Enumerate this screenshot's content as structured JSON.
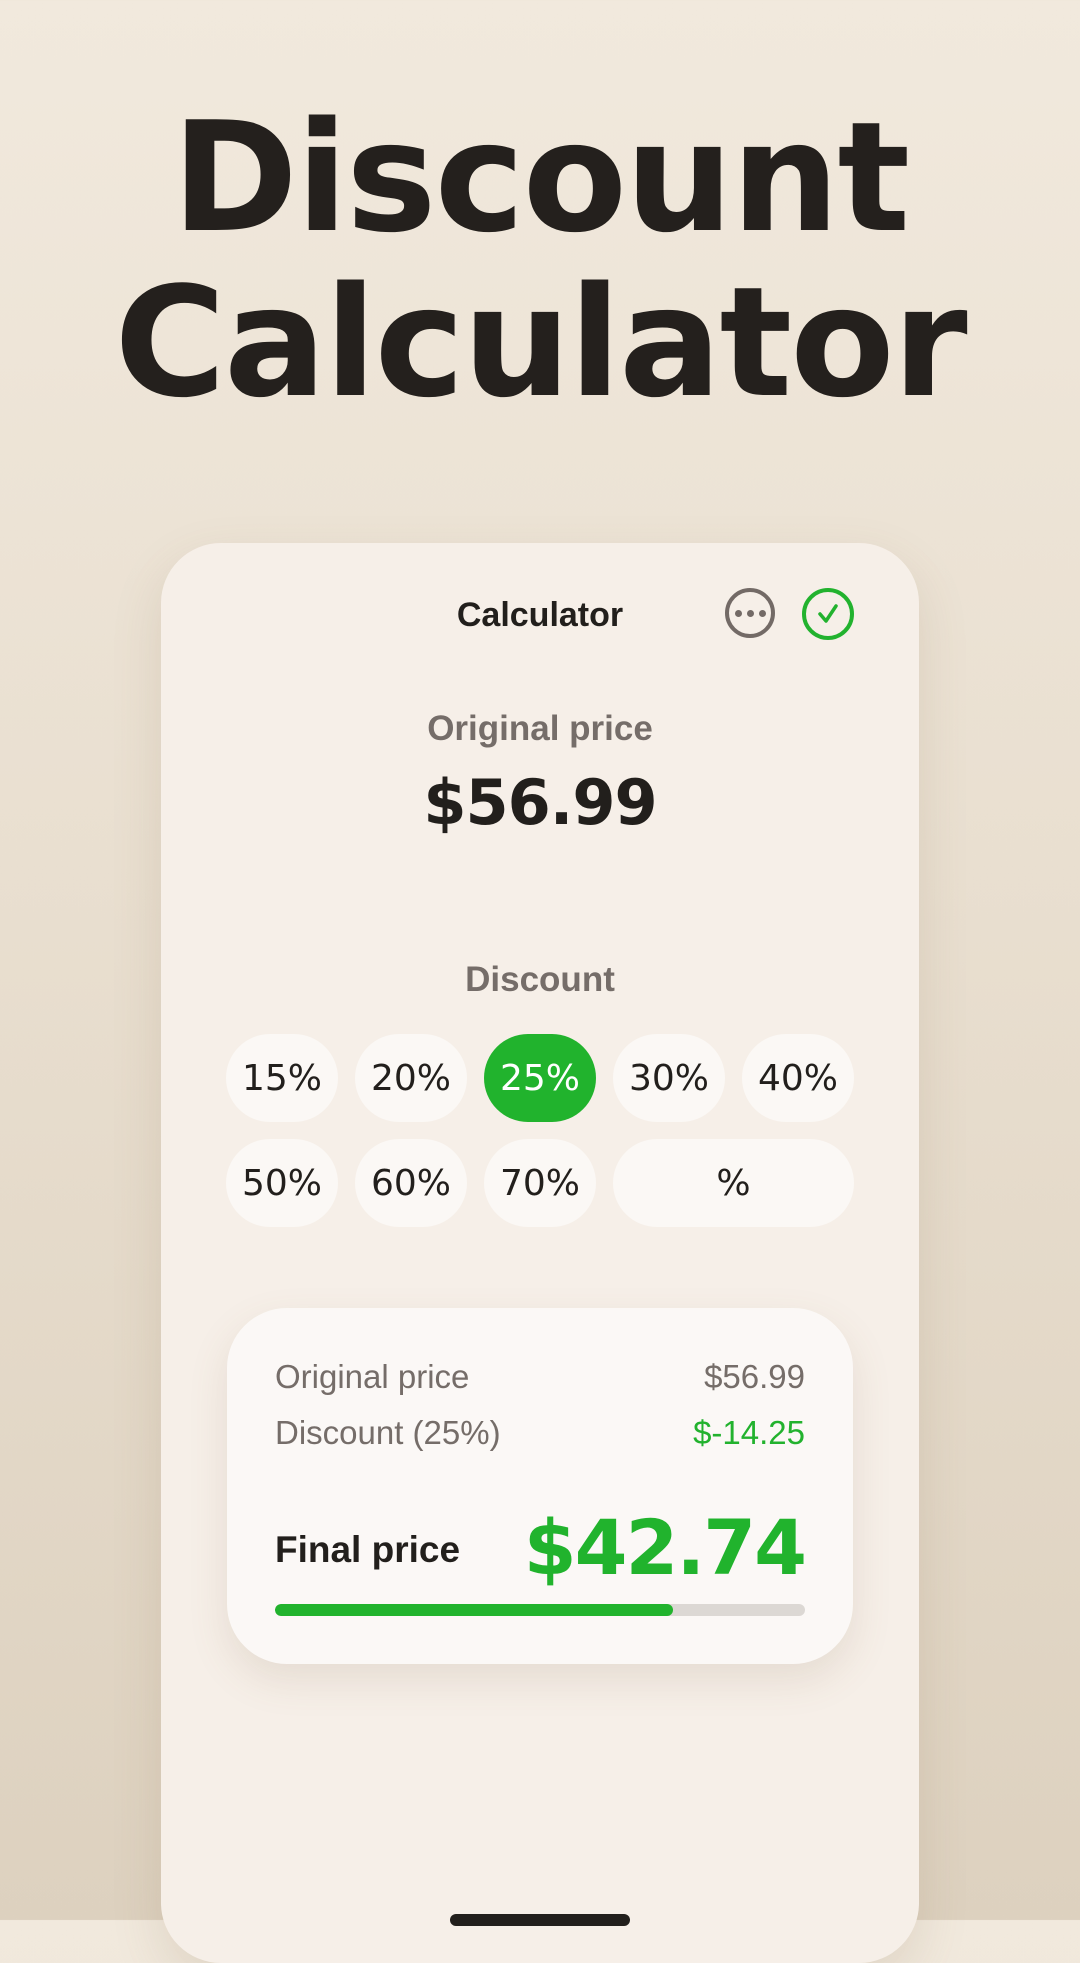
{
  "headline": {
    "line1": "Discount",
    "line2": "Calculator"
  },
  "header": {
    "title": "Calculator",
    "more_icon": "more-horizontal-icon",
    "confirm_icon": "check-circle-icon"
  },
  "original": {
    "label": "Original price",
    "value": "$56.99"
  },
  "discount": {
    "label": "Discount",
    "options": [
      "15%",
      "20%",
      "25%",
      "30%",
      "40%",
      "50%",
      "60%",
      "70%"
    ],
    "selected": "25%",
    "custom_placeholder": "%"
  },
  "summary": {
    "original_label": "Original price",
    "original_value": "$56.99",
    "discount_label": "Discount (25%)",
    "discount_value": "$-14.25",
    "final_label": "Final price",
    "final_value": "$42.74",
    "progress_fraction": 0.75
  },
  "colors": {
    "accent": "#21b32d",
    "text": "#221f1c",
    "muted": "#756d69",
    "card": "#f6efe8"
  }
}
